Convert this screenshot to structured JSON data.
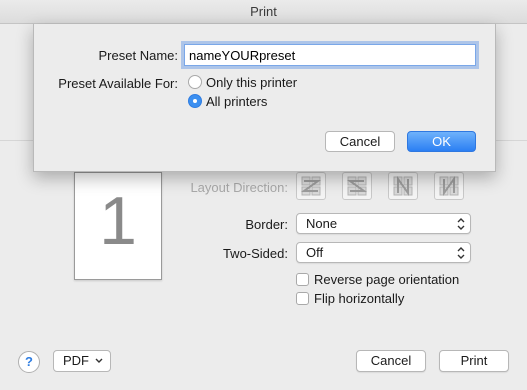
{
  "window": {
    "title": "Print"
  },
  "preview": {
    "page_number": "1"
  },
  "layout": {
    "direction_label": "Layout Direction:",
    "border_label": "Border:",
    "border_value": "None",
    "two_sided_label": "Two-Sided:",
    "two_sided_value": "Off",
    "reverse_label": "Reverse page orientation",
    "flip_label": "Flip horizontally"
  },
  "footer": {
    "help": "?",
    "pdf": "PDF",
    "cancel": "Cancel",
    "print": "Print"
  },
  "sheet": {
    "preset_name_label": "Preset Name:",
    "preset_name_value": "nameYOURpreset",
    "available_label": "Preset Available For:",
    "option_only": "Only this printer",
    "option_all": "All printers",
    "selected_option": "All printers",
    "cancel": "Cancel",
    "ok": "OK"
  },
  "colors": {
    "accent": "#2f7de1",
    "ok_button": "#3b8ff0"
  }
}
